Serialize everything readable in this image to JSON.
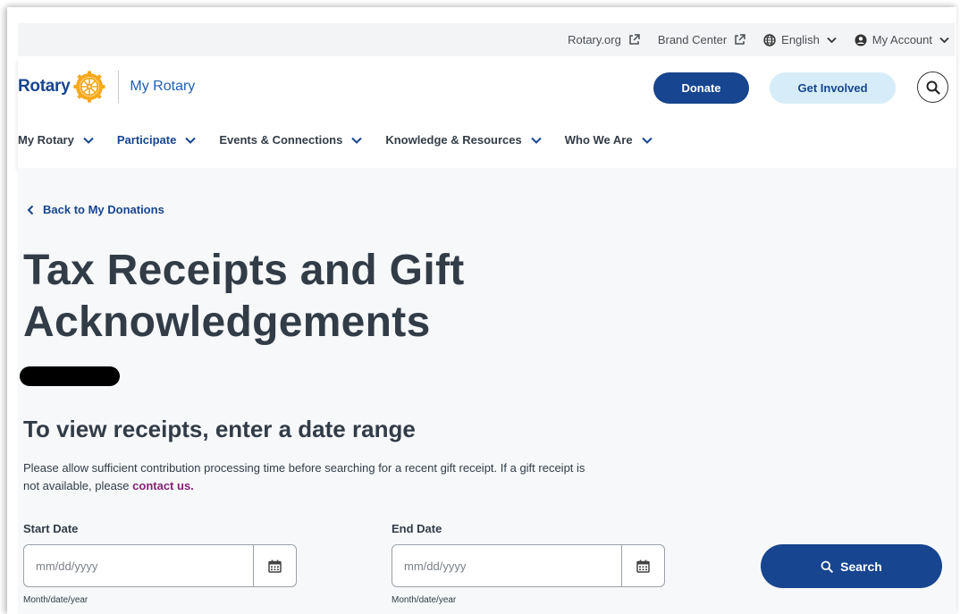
{
  "utility": {
    "links": [
      {
        "label": "Rotary.org",
        "icon": "external-link-icon"
      },
      {
        "label": "Brand Center",
        "icon": "external-link-icon"
      },
      {
        "label": "English",
        "icon": "globe-icon"
      },
      {
        "label": "My Account",
        "icon": "user-icon"
      }
    ]
  },
  "header": {
    "logo_word": "Rotary",
    "site_name": "My Rotary",
    "donate_label": "Donate",
    "involved_label": "Get Involved"
  },
  "nav": {
    "items": [
      {
        "label": "My Rotary"
      },
      {
        "label": "Participate"
      },
      {
        "label": "Events & Connections"
      },
      {
        "label": "Knowledge & Resources"
      },
      {
        "label": "Who We Are"
      }
    ]
  },
  "main": {
    "back_label": "Back to My Donations",
    "title": "Tax Receipts and Gift Acknowledgements",
    "subtitle": "To view receipts, enter a date range",
    "help_text": "Please allow sufficient contribution processing time before searching for a recent gift receipt. If a gift receipt is not available, please ",
    "help_link": "contact us.",
    "start_date": {
      "label": "Start Date",
      "placeholder": "mm/dd/yyyy",
      "value": "",
      "hint": "Month/date/year"
    },
    "end_date": {
      "label": "End Date",
      "placeholder": "mm/dd/yyyy",
      "value": "",
      "hint": "Month/date/year"
    },
    "search_label": "Search"
  },
  "colors": {
    "brand_blue": "#17458f",
    "light_blue": "#d6ecf8",
    "link_purple": "#872175",
    "gold": "#f7a81b"
  }
}
